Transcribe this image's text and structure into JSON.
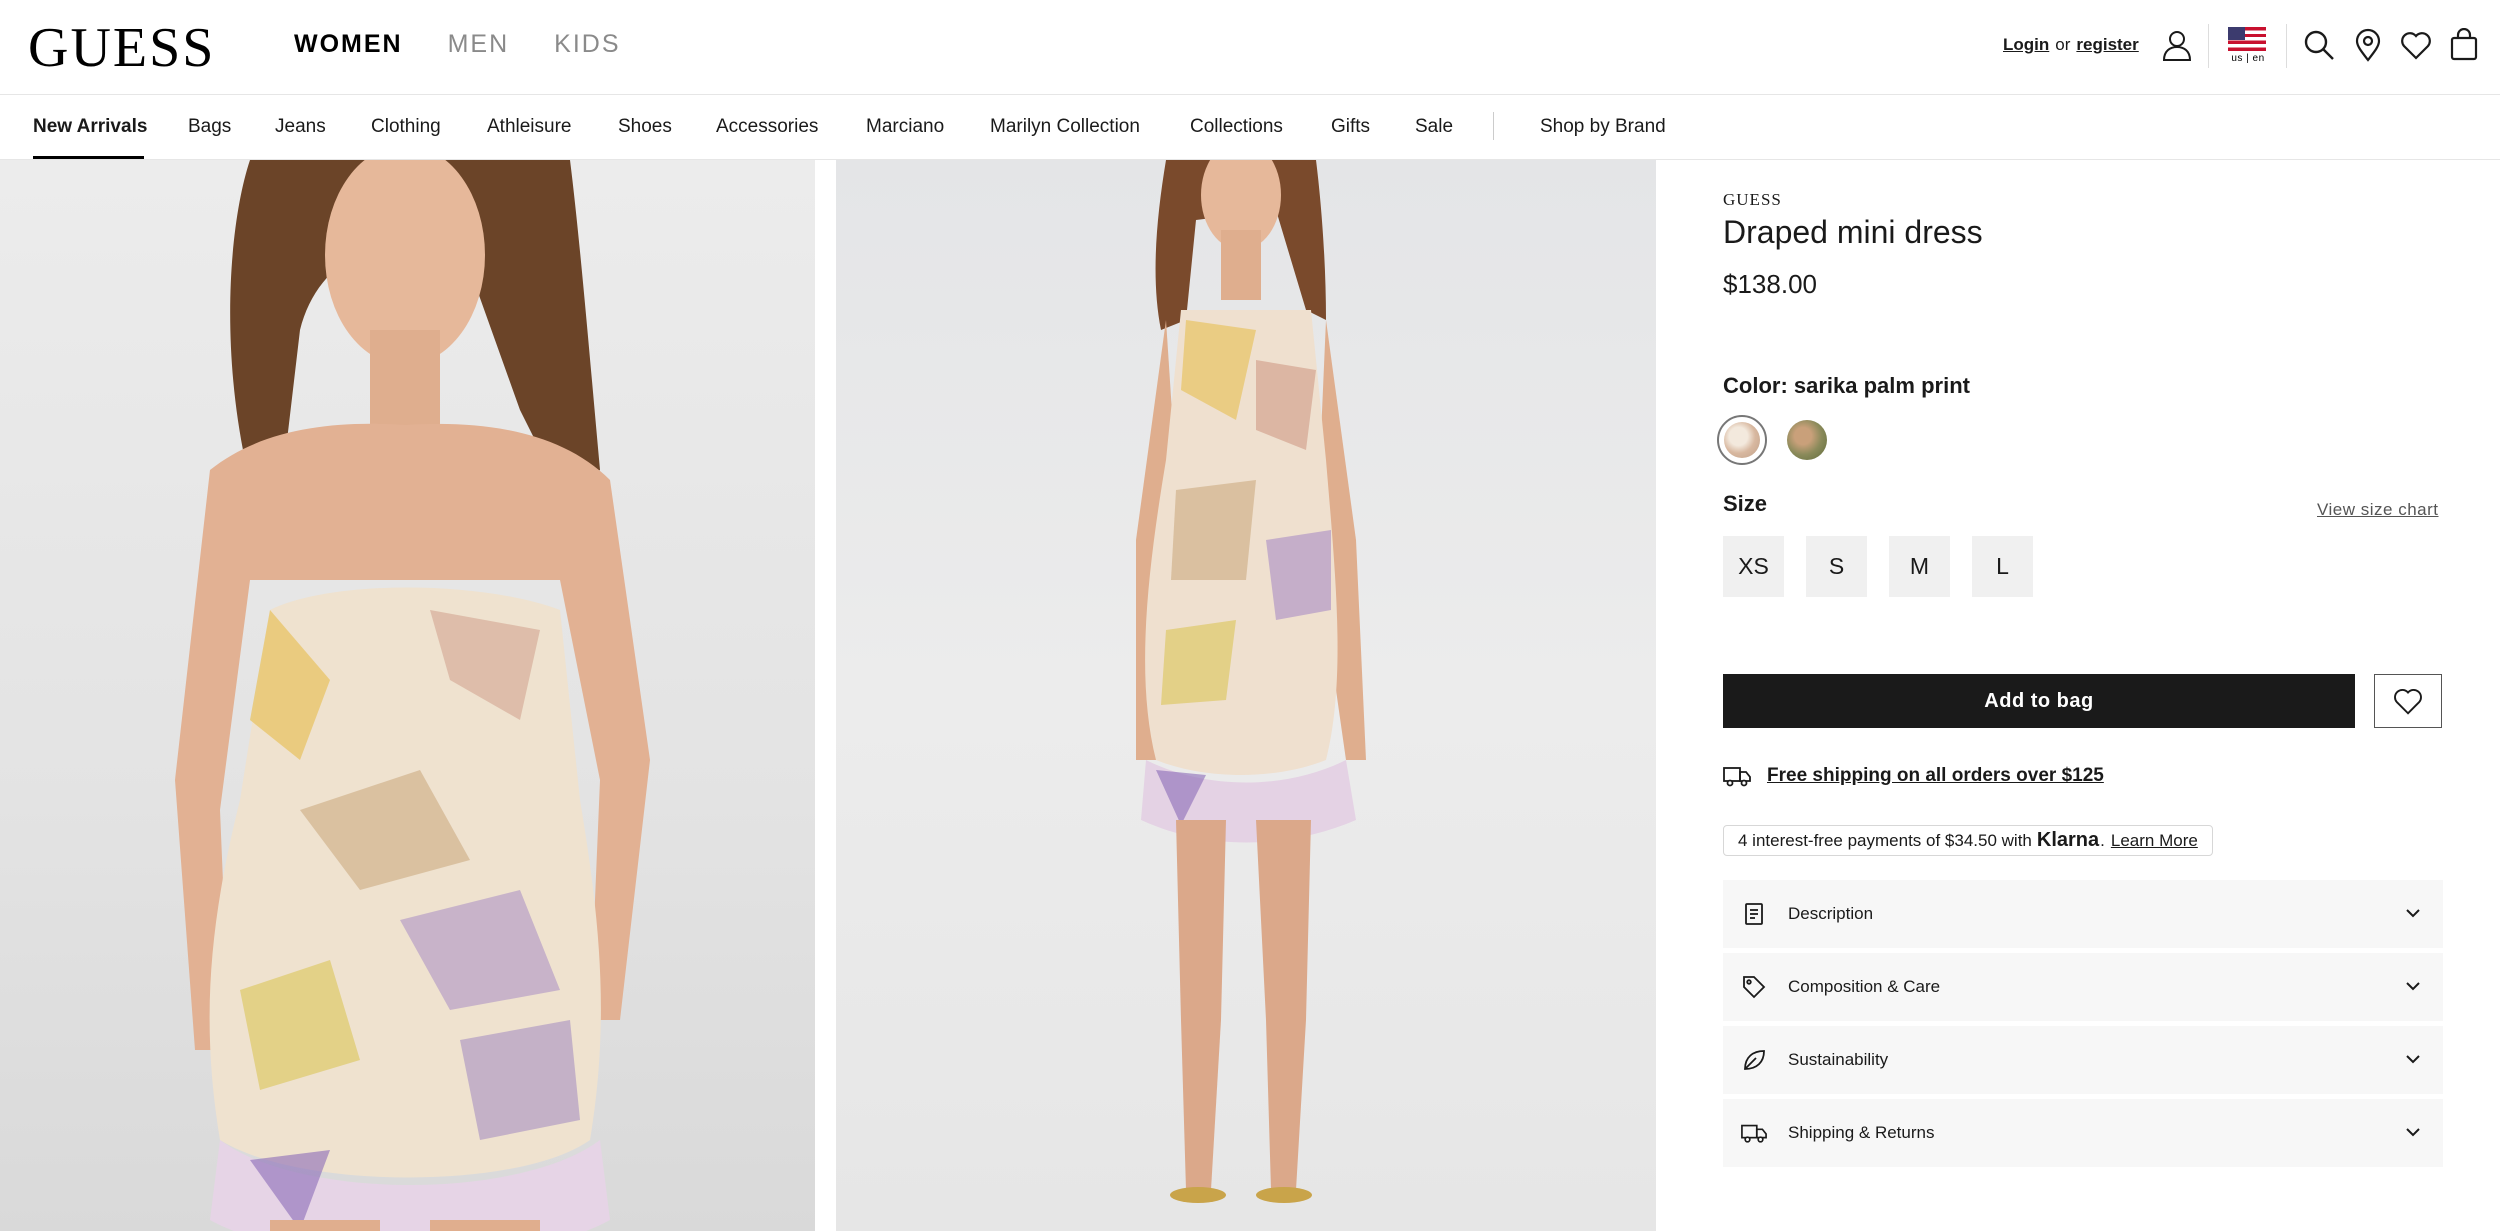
{
  "header": {
    "logo": "GUESS",
    "gender_tabs": [
      {
        "label": "WOMEN",
        "active": true
      },
      {
        "label": "MEN",
        "active": false
      },
      {
        "label": "KIDS",
        "active": false
      }
    ],
    "login": "Login",
    "or": "or",
    "register": "register",
    "locale": "us | en",
    "icons": [
      "user-icon",
      "us-flag-icon",
      "search-icon",
      "store-locator-icon",
      "heart-icon",
      "bag-icon"
    ]
  },
  "category_nav": {
    "items": [
      "New Arrivals",
      "Bags",
      "Jeans",
      "Clothing",
      "Athleisure",
      "Shoes",
      "Accessories",
      "Marciano",
      "Marilyn Collection",
      "Collections",
      "Gifts",
      "Sale"
    ],
    "active": "New Arrivals",
    "shop_by_brand": "Shop by Brand"
  },
  "product": {
    "brand": "GUESS",
    "name": "Draped mini dress",
    "price": "$138.00",
    "color_label": "Color:",
    "color_value": "sarika palm print",
    "swatches": [
      {
        "name": "sarika palm print",
        "color": "#e8d8c8",
        "selected": true
      },
      {
        "name": "green palm print",
        "color": "#8a8a5a",
        "selected": false
      }
    ],
    "size_label": "Size",
    "size_chart": "View size chart",
    "sizes": [
      "XS",
      "S",
      "M",
      "L"
    ],
    "add_to_bag": "Add to bag",
    "shipping": "Free shipping on all orders over $125",
    "klarna": {
      "prefix": "4 interest-free payments of $34.50 with",
      "brand": "Klarna",
      "dot": ".",
      "learn_more": "Learn More"
    },
    "accordions": [
      {
        "label": "Description",
        "icon": "document-icon"
      },
      {
        "label": "Composition & Care",
        "icon": "tag-icon"
      },
      {
        "label": "Sustainability",
        "icon": "leaf-icon"
      },
      {
        "label": "Shipping & Returns",
        "icon": "truck-icon"
      }
    ]
  },
  "colors": {
    "primary": "#1a1a1a",
    "muted_nav": "#8a8a8a",
    "accordion_bg": "#f7f7f7",
    "size_bg": "#f0f0f0"
  }
}
